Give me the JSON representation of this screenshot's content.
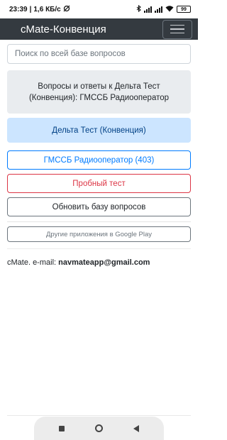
{
  "status_bar": {
    "time": "23:39",
    "separator": "|",
    "speed": "1,6 КБ/с",
    "battery": "99"
  },
  "app_bar": {
    "title": "cMate-Конвенция"
  },
  "search": {
    "placeholder": "Поиск по всей базе вопросов"
  },
  "info_box": {
    "text": "Вопросы и ответы к Дельта Тест (Конвенция): ГМССБ Радиооператор"
  },
  "buttons": {
    "delta_test": "Дельта Тест (Конвенция)",
    "gmdss": "ГМССБ Радиооператор (403)",
    "trial_test": "Пробный тест",
    "update_db": "Обновить базу вопросов",
    "other_apps": "Другие приложения в Google Play"
  },
  "footer": {
    "prefix": "cMate. e-mail:",
    "email": "navmateapp@gmail.com"
  },
  "colors": {
    "app_bar": "#343a40",
    "primary": "#007bff",
    "danger": "#dc3545",
    "info_bg": "#e9ecef",
    "primary_light_bg": "#cce5ff"
  }
}
